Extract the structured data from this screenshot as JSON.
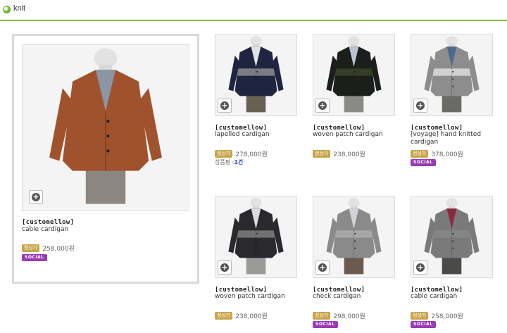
{
  "header": {
    "title": "knit",
    "accent": "#79c13a"
  },
  "price_tag_label": "정상가",
  "social_label": "SOCIAL",
  "zoom_icon": "plus-icon",
  "featured": {
    "brand": "[customellow]",
    "name": "cable cardigan",
    "price": "258,000원",
    "social": true,
    "colors": {
      "sweater": "#a0522d",
      "shirt": "#8a96a6",
      "pants": "#8c8680"
    }
  },
  "products": [
    {
      "brand": "[customellow]",
      "name": "lapelled cardigan",
      "price": "278,000원",
      "review_label": "상품평 :",
      "review_count": "1건",
      "colors": {
        "sweater": "#1f2540",
        "stripe": "#9a9a9a",
        "shirt": "#dfe3e8",
        "pants": "#6a5f55"
      }
    },
    {
      "brand": "[customellow]",
      "name": "woven patch cardigan",
      "price": "238,000원",
      "colors": {
        "sweater": "#1a1f1c",
        "stripe": "#3e4a2a",
        "shirt": "#b8c4d2",
        "pants": "#8a8a86"
      }
    },
    {
      "brand": "[customellow]",
      "name": "[voyage] hand knitted cardigan",
      "price": "378,000원",
      "social": true,
      "colors": {
        "sweater": "#8d8d8d",
        "stripe": "#e8e8e8",
        "shirt": "#4e6a8a",
        "pants": "#6a6a66"
      }
    },
    {
      "brand": "[customellow]",
      "name": "woven patch cardigan",
      "price": "238,000원",
      "colors": {
        "sweater": "#2a2a2e",
        "stripe": "#8a8a8a",
        "shirt": "#d8dce0",
        "pants": "#9a9a96"
      }
    },
    {
      "brand": "[customellow]",
      "name": "check cardigan",
      "price": "298,000원",
      "social": true,
      "colors": {
        "sweater": "#8a8a8a",
        "stripe": "#b0b0b0",
        "shirt": "#d0d4d8",
        "pants": "#6a5a50"
      }
    },
    {
      "brand": "[customellow]",
      "name": "cable cardigan",
      "price": "258,000원",
      "social": true,
      "colors": {
        "sweater": "#7a7a7a",
        "stripe": "#8a8a8a",
        "shirt": "#8a2a3a",
        "pants": "#4a4a48"
      }
    }
  ]
}
